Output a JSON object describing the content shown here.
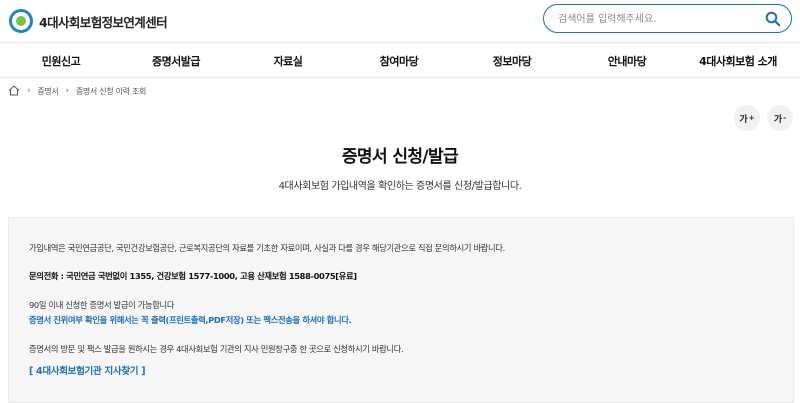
{
  "header": {
    "logo_text": "4대사회보험정보연계센터",
    "search": {
      "placeholder": "검색어를 입력해주세요."
    }
  },
  "gnb": {
    "items": [
      "민원신고",
      "증명서발급",
      "자료실",
      "참여마당",
      "정보마당",
      "안내마당",
      "4대사회보험 소개"
    ]
  },
  "breadcrumb": {
    "items": [
      "증명서",
      "증명서 신청 이력 조회"
    ]
  },
  "font_controls": {
    "increase_label": "가",
    "increase_mark": "+",
    "decrease_label": "가",
    "decrease_mark": "-"
  },
  "page": {
    "title": "증명서 신청/발급",
    "subtitle": "4대사회보험 가입내역을 확인하는 증명서를 신청/발급합니다."
  },
  "info": {
    "line1": "가입내역은 국민연금공단, 국민건강보험공단, 근로복지공단의 자료를 기초한 자료이며, 사실과 다를 경우 해당기관으로 직접 문의하시기 바랍니다.",
    "contact": "문의전화 : 국민연금 국번없이 1355, 건강보험 1577-1000, 고용 산재보험 1588-0075[유료]",
    "line3": "90일 이내 신청한 증명서 발급이 가능합니다",
    "line4": "증명서 진위여부 확인을 위해서는 꼭 출력(프린트출력,PDF저장) 또는 팩스전송을 하셔야 합니다.",
    "line5": "증명서의 방문 및 팩스 발급을 원하시는 경우 4대사회보험 기관의 지사 민원창구중 한 곳으로 신청하시기 바랍니다.",
    "link": "[ 4대사회보험기관 지사찾기 ]"
  },
  "colors": {
    "accent": "#1d6fb8",
    "logo_blue": "#1d86c8",
    "logo_green": "#7cc242",
    "box_bg": "#f6f6f6"
  }
}
